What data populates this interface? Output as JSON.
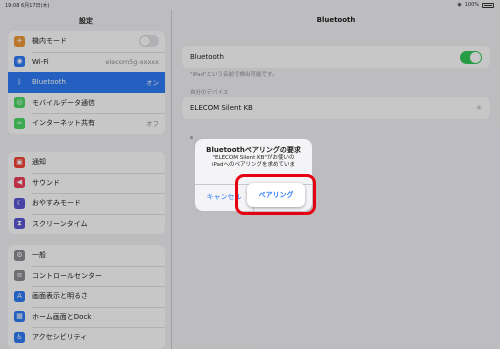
{
  "statusbar": {
    "time": "19:08",
    "date": "6月17日(木)",
    "battery": "100%"
  },
  "sidebar": {
    "title": "設定",
    "group1": [
      {
        "label": "機内モード",
        "icon": "airplane-icon",
        "color": "#f19a37",
        "glyph": "✈",
        "toggle": true
      },
      {
        "label": "Wi-Fi",
        "value": "elecom5g-xxxxx",
        "icon": "wifi-icon",
        "color": "#2f7cf6",
        "glyph": "◉"
      },
      {
        "label": "Bluetooth",
        "value": "オン",
        "icon": "bluetooth-icon",
        "color": "#2f7cf6",
        "glyph": "ᛒ",
        "selected": true
      },
      {
        "label": "モバイルデータ通信",
        "icon": "antenna-icon",
        "color": "#4cd964",
        "glyph": "◎"
      },
      {
        "label": "インターネット共有",
        "value": "オフ",
        "icon": "link-icon",
        "color": "#4cd964",
        "glyph": "∞"
      }
    ],
    "group2": [
      {
        "label": "通知",
        "icon": "notification-icon",
        "color": "#f44336",
        "glyph": "▣"
      },
      {
        "label": "サウンド",
        "icon": "speaker-icon",
        "color": "#f03e5a",
        "glyph": "◀"
      },
      {
        "label": "おやすみモード",
        "icon": "moon-icon",
        "color": "#5a57d6",
        "glyph": "☾"
      },
      {
        "label": "スクリーンタイム",
        "icon": "hourglass-icon",
        "color": "#5a57d6",
        "glyph": "⧗"
      }
    ],
    "group3": [
      {
        "label": "一般",
        "icon": "gear-icon",
        "color": "#8e8e93",
        "glyph": "⚙"
      },
      {
        "label": "コントロールセンター",
        "icon": "switches-icon",
        "color": "#8e8e93",
        "glyph": "≡"
      },
      {
        "label": "画面表示と明るさ",
        "icon": "text-size-icon",
        "color": "#2f7cf6",
        "glyph": "A"
      },
      {
        "label": "ホーム画面とDock",
        "icon": "grid-icon",
        "color": "#2f7cf6",
        "glyph": "▦"
      },
      {
        "label": "アクセシビリティ",
        "icon": "accessibility-icon",
        "color": "#2f7cf6",
        "glyph": "♿"
      }
    ]
  },
  "main": {
    "title": "Bluetooth",
    "bluetooth_label": "Bluetooth",
    "bluetooth_caption": "\"iPad\"という名前で検出可能です。",
    "devices_header": "自分のデバイス",
    "device_name": "ELECOM Silent KB"
  },
  "alert": {
    "title": "Bluetoothペアリングの要求",
    "message_line1": "\"ELECOM Silent KB\"がお使いの",
    "message_line2": "iPadへのペアリングを求めていま",
    "cancel_label": "キャンセル",
    "pair_label": "ペアリング"
  },
  "colors": {
    "accent": "#2f7cf6",
    "switch_on": "#34c759",
    "highlight": "#e50012"
  }
}
